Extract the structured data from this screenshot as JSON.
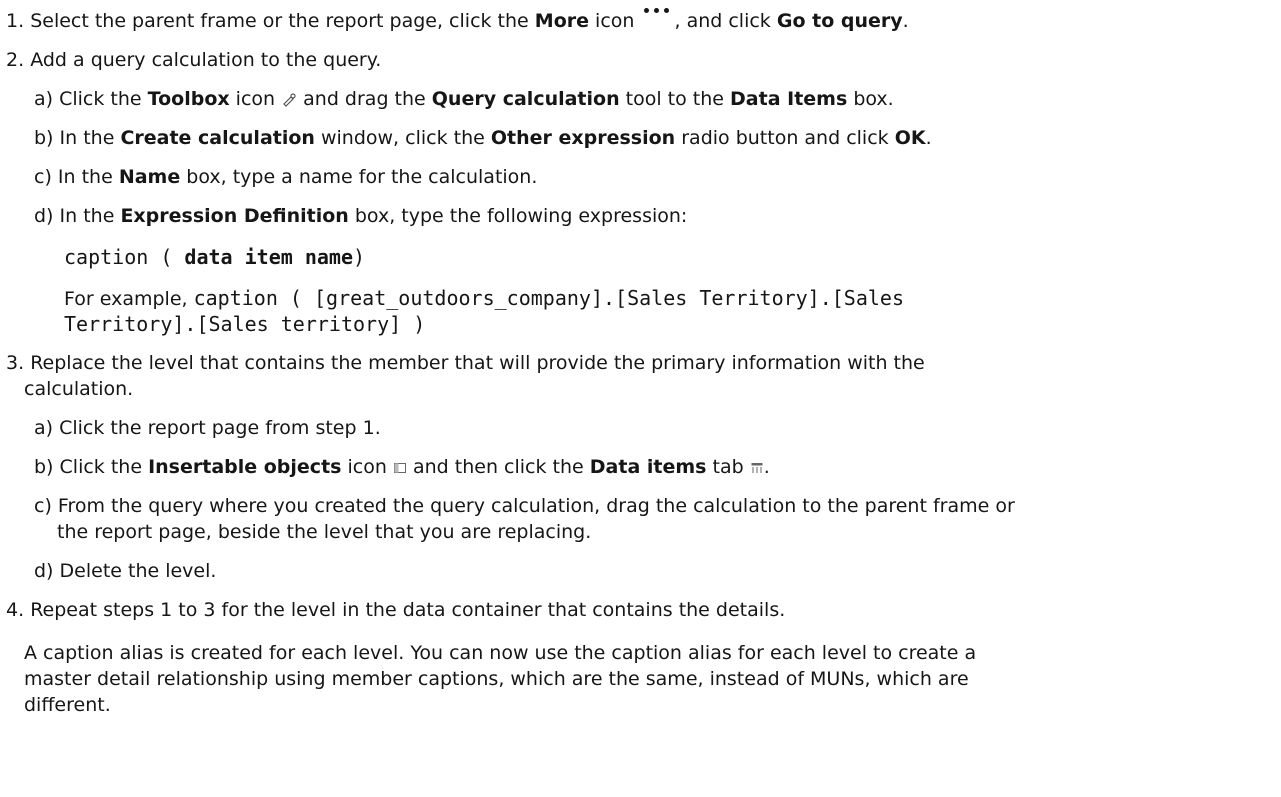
{
  "steps": {
    "s1": {
      "num": "1.",
      "t1": "Select the parent frame or the report page, click the ",
      "b1": "More",
      "t2": " icon ",
      "t3": ", and click ",
      "b2": "Go to query",
      "t4": "."
    },
    "s2": {
      "num": "2.",
      "text": "Add a query calculation to the query.",
      "a": {
        "label": "a)",
        "t1": "Click the ",
        "b1": "Toolbox",
        "t2": " icon ",
        "t3": " and drag the ",
        "b2": "Query calculation",
        "t4": " tool to the ",
        "b3": "Data Items",
        "t5": " box."
      },
      "b": {
        "label": "b)",
        "t1": "In the ",
        "b1": "Create calculation",
        "t2": " window, click the ",
        "b2": "Other expression",
        "t3": " radio button and click ",
        "b3": "OK",
        "t4": "."
      },
      "c": {
        "label": "c)",
        "t1": "In the ",
        "b1": "Name",
        "t2": " box, type a name for the calculation."
      },
      "d": {
        "label": "d)",
        "t1": "In the ",
        "b1": "Expression Definition",
        "t2": " box, type the following expression:",
        "code1": "caption (",
        "code_bold": "data item name",
        "code2": ")",
        "example_label": "For example, ",
        "example_code1": "caption ( [great_outdoors_company].[Sales Territory].[Sales",
        "example_code2": "Territory].[Sales territory] )"
      }
    },
    "s3": {
      "num": "3.",
      "text1": "Replace the level that contains the member that will provide the primary information with the",
      "text2": "calculation.",
      "a": {
        "label": "a)",
        "text": "Click the report page from step 1."
      },
      "b": {
        "label": "b)",
        "t1": "Click the ",
        "b1": "Insertable objects",
        "t2": " icon ",
        "t3": " and then click the ",
        "b2": "Data items",
        "t4": " tab ",
        "t5": "."
      },
      "c": {
        "label": "c)",
        "text1": "From the query where you created the query calculation, drag the calculation to the parent frame or",
        "text2": "the report page, beside the level that you are replacing."
      },
      "d": {
        "label": "d)",
        "text": "Delete the level."
      }
    },
    "s4": {
      "num": "4.",
      "text": "Repeat steps 1 to 3 for the level in the data container that contains the details.",
      "para1": "A caption alias is created for each level. You can now use the caption alias for each level to create a",
      "para2": "master detail relationship using member captions, which are the same, instead of MUNs, which are",
      "para3": "different."
    }
  },
  "icons": {
    "more": "more-icon",
    "toolbox": "toolbox-icon",
    "insertable": "insertable-objects-icon",
    "dataitems": "data-items-tab-icon"
  }
}
